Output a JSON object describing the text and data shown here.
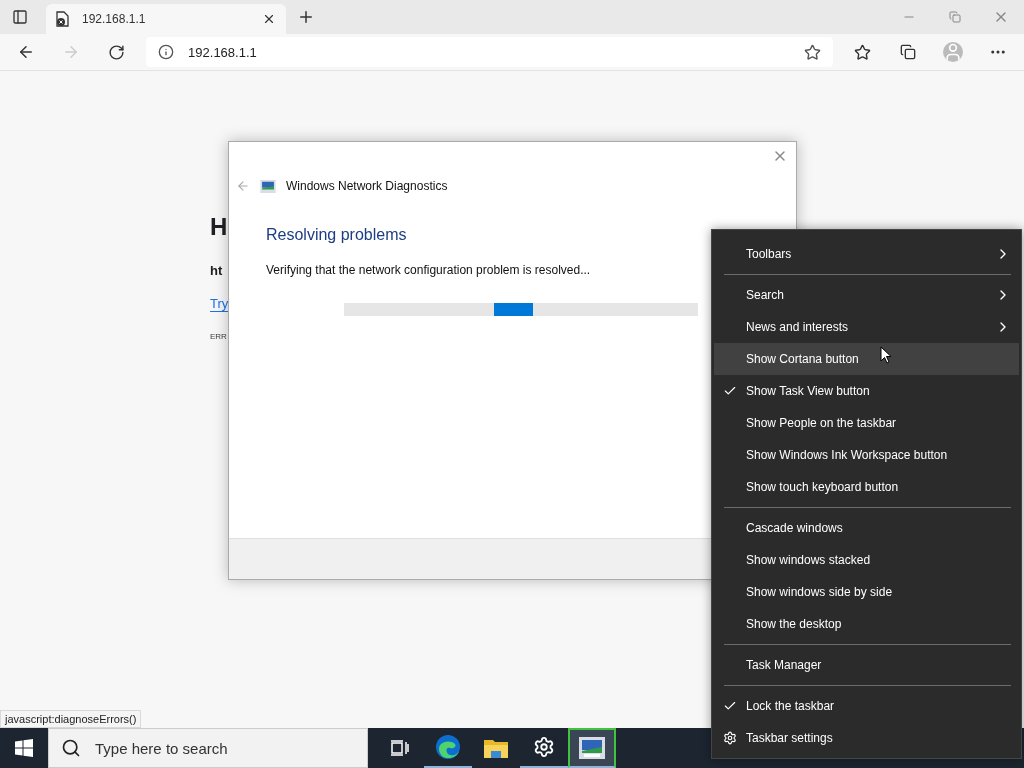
{
  "browser": {
    "tabs": [
      {
        "title": "192.168.1.1",
        "selected": true
      }
    ],
    "address": "192.168.1.1"
  },
  "page": {
    "texts": [
      {
        "kind": "heading",
        "text": "H"
      },
      {
        "kind": "bold",
        "text": "ht"
      },
      {
        "kind": "link",
        "text": "Try"
      },
      {
        "kind": "code",
        "text": "ERR"
      }
    ]
  },
  "status_url": "javascript:diagnoseErrors()",
  "dialog": {
    "title": "Windows Network Diagnostics",
    "heading": "Resolving problems",
    "message": "Verifying that the network configuration problem is resolved...",
    "progress": {
      "indeterminate": true
    }
  },
  "context_menu": {
    "sections": [
      [
        {
          "label": "Toolbars",
          "kind": "command",
          "submenu": true,
          "checked": false,
          "selected": false
        }
      ],
      [
        {
          "label": "Search",
          "kind": "command",
          "submenu": true,
          "checked": false,
          "selected": false
        },
        {
          "label": "News and interests",
          "kind": "command",
          "submenu": true,
          "checked": false,
          "selected": false
        },
        {
          "label": "Show Cortana button",
          "kind": "command",
          "submenu": false,
          "checked": false,
          "selected": true
        },
        {
          "label": "Show Task View button",
          "kind": "command",
          "submenu": false,
          "checked": true,
          "selected": false
        },
        {
          "label": "Show People on the taskbar",
          "kind": "command",
          "submenu": false,
          "checked": false,
          "selected": false
        },
        {
          "label": "Show Windows Ink Workspace button",
          "kind": "command",
          "submenu": false,
          "checked": false,
          "selected": false
        },
        {
          "label": "Show touch keyboard button",
          "kind": "command",
          "submenu": false,
          "checked": false,
          "selected": false
        }
      ],
      [
        {
          "label": "Cascade windows",
          "kind": "command",
          "submenu": false,
          "checked": false,
          "selected": false
        },
        {
          "label": "Show windows stacked",
          "kind": "command",
          "submenu": false,
          "checked": false,
          "selected": false
        },
        {
          "label": "Show windows side by side",
          "kind": "command",
          "submenu": false,
          "checked": false,
          "selected": false
        },
        {
          "label": "Show the desktop",
          "kind": "command",
          "submenu": false,
          "checked": false,
          "selected": false
        }
      ],
      [
        {
          "label": "Task Manager",
          "kind": "command",
          "submenu": false,
          "checked": false,
          "selected": false
        }
      ],
      [
        {
          "label": "Lock the taskbar",
          "kind": "command",
          "submenu": false,
          "checked": true,
          "selected": false
        },
        {
          "label": "Taskbar settings",
          "kind": "settings",
          "submenu": false,
          "checked": false,
          "selected": false
        }
      ]
    ]
  },
  "taskbar": {
    "search_placeholder": "Type here to search",
    "apps": [
      {
        "kind": "taskview",
        "running": false,
        "active": false
      },
      {
        "kind": "edge",
        "running": true,
        "active": false
      },
      {
        "kind": "folder",
        "running": false,
        "active": false
      },
      {
        "kind": "settings",
        "running": true,
        "active": false
      },
      {
        "kind": "diagnostics",
        "running": true,
        "active": true
      }
    ]
  }
}
